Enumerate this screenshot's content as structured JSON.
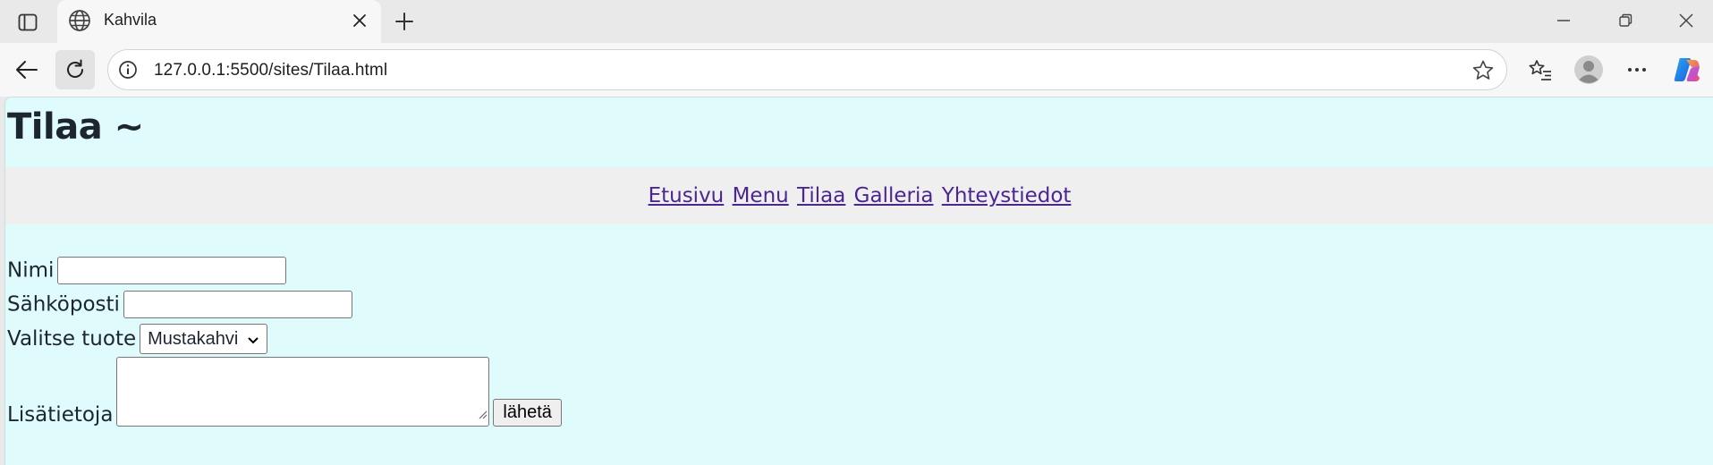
{
  "browser": {
    "tab": {
      "title": "Kahvila"
    },
    "address": {
      "url": "127.0.0.1:5500/sites/Tilaa.html"
    }
  },
  "page": {
    "heading": "Tilaa ~",
    "nav": [
      "Etusivu",
      "Menu",
      "Tilaa",
      "Galleria",
      "Yhteystiedot"
    ],
    "form": {
      "name_label": "Nimi",
      "name_value": "",
      "email_label": "Sähköposti",
      "email_value": "",
      "product_label": "Valitse tuote",
      "product_selected": "Mustakahvi",
      "info_label": "Lisätietoja",
      "info_value": "",
      "submit_label": "lähetä"
    }
  },
  "colors": {
    "page_background": "#e0fbfc",
    "nav_background": "#efefef",
    "link": "#4b2691",
    "heading": "#1c2530"
  }
}
